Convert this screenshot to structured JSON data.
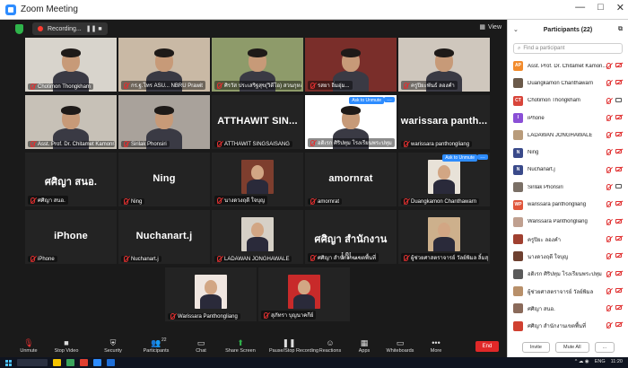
{
  "window": {
    "title": "Zoom Meeting",
    "controls": [
      "—",
      "□",
      "✕"
    ]
  },
  "meeting": {
    "recording_text": "Recording...",
    "recording_controls": "❚❚  ■",
    "view_label": "View",
    "tiles": [
      {
        "label": "Chotimon Thongkham",
        "type": "video",
        "bg": "#d8d4cc"
      },
      {
        "label": "กร.ฐ.โทร ASU...  NBRU Prawit",
        "type": "video",
        "bg": "#c9b9a5"
      },
      {
        "label": "ศิรวัส ประเสริฐสุข(วิดีโอ) สวนกุหลาบ นนทบุรี",
        "type": "video",
        "bg": "#8e9b6a"
      },
      {
        "label": "รสยา  อิ่มอุ่ม... ",
        "type": "video",
        "bg": "#7a2e2a",
        "active": true
      },
      {
        "label": "ครูปิยะพันธ์ ลองคำ",
        "type": "video",
        "bg": "#cfc7bd"
      },
      {
        "label": "Asst. Prof. Dr. Chitamet Kamonrat",
        "type": "video",
        "bg": "#c7c1b7"
      },
      {
        "label": "Sirilak Phonsiri",
        "type": "video",
        "bg": "#a9a29b"
      },
      {
        "label": "ATTHAWIT SINGSAISANG",
        "type": "name",
        "name": "ATTHAWIT SIN..."
      },
      {
        "label": "อดิเรก ศิริปทุม โรงเรียนพระปทุม",
        "type": "video",
        "bg": "#ffffff",
        "chip": "Ask to Unmute"
      },
      {
        "label": "warissara panthongliang",
        "type": "name",
        "name": "warissara  panth..."
      },
      {
        "label": "ศศิญา สนอ.",
        "type": "name",
        "name": "ศศิญา สนอ."
      },
      {
        "label": "Ning",
        "type": "name",
        "name": "Ning"
      },
      {
        "label": "นางดวงฤดี ใจบุญ",
        "type": "photo",
        "bg": "#7e3e2e"
      },
      {
        "label": "amornrat",
        "type": "name",
        "name": "amornrat"
      },
      {
        "label": "Duangkamon Chanthawarn",
        "type": "photo",
        "bg": "#e8e2d8",
        "chip": "Ask to Unmute"
      },
      {
        "label": "iPhone",
        "type": "name",
        "name": "iPhone"
      },
      {
        "label": "Nuchanart.j",
        "type": "name",
        "name": "Nuchanart.j"
      },
      {
        "label": "LADAWAN JONGHAWALE",
        "type": "photo",
        "bg": "#d6d0c6"
      },
      {
        "label": "ศศิญา สำนักงานเขตพื้นที่",
        "type": "name",
        "name": "ศศิญา สำนักงานเข..."
      },
      {
        "label": "ผู้ช่วยศาสตราจารย์ วัลย์พิมล ลิ้มสุดใจ",
        "type": "photo",
        "bg": "#cdb08c"
      },
      {
        "label": "Warissara Panthongliang",
        "type": "photo",
        "bg": "#f0e6e0"
      },
      {
        "label": "สุภัทรา บุญนาคกีย์",
        "type": "photo",
        "bg": "#c82a2a"
      }
    ]
  },
  "toolbar": {
    "items": [
      {
        "label": "Unmute",
        "icon": "mic-muted-icon"
      },
      {
        "label": "Stop Video",
        "icon": "video-icon"
      },
      {
        "label": "Security",
        "icon": "shield-icon"
      },
      {
        "label": "Participants",
        "icon": "participants-icon",
        "count": "22"
      },
      {
        "label": "Chat",
        "icon": "chat-icon"
      },
      {
        "label": "Share Screen",
        "icon": "share-screen-icon"
      },
      {
        "label": "Pause/Stop Recording",
        "icon": "pause-recording-icon"
      },
      {
        "label": "Reactions",
        "icon": "reactions-icon"
      },
      {
        "label": "Apps",
        "icon": "apps-icon"
      },
      {
        "label": "Whiteboards",
        "icon": "whiteboard-icon"
      },
      {
        "label": "More",
        "icon": "more-icon"
      }
    ],
    "end_label": "End"
  },
  "panel": {
    "title": "Participants (22)",
    "search_placeholder": "Find a participant",
    "participants": [
      {
        "name": "Asst. Prof. Dr. Chitamet Kamon...",
        "initials": "AP",
        "color": "#f28b2c",
        "cam": "off"
      },
      {
        "name": "Duangkamon Chanthawarn",
        "initials": "",
        "color": "#6b5a4a",
        "cam": "off"
      },
      {
        "name": "Chotimon Thongkham",
        "initials": "CT",
        "color": "#d8453a",
        "cam": "on"
      },
      {
        "name": "iPhone",
        "initials": "I",
        "color": "#8a4fd6",
        "cam": "off"
      },
      {
        "name": "LADAWAN JONGHAWALE",
        "initials": "",
        "color": "#b89b7a",
        "cam": "off"
      },
      {
        "name": "Ning",
        "initials": "N",
        "color": "#3a4a8a",
        "cam": "off"
      },
      {
        "name": "Nuchanart.j",
        "initials": "N",
        "color": "#3a4a8a",
        "cam": "off"
      },
      {
        "name": "Sirilak Phonsiri",
        "initials": "",
        "color": "#7a6f66",
        "cam": "on"
      },
      {
        "name": "warissara panthongliang",
        "initials": "WP",
        "color": "#e0553a",
        "cam": "off"
      },
      {
        "name": "Warissara Panthongliang",
        "initials": "",
        "color": "#c0a090",
        "cam": "off"
      },
      {
        "name": "ครูปิยะ ลองคำ",
        "initials": "",
        "color": "#a04030",
        "cam": "off"
      },
      {
        "name": "นางดวงฤดี ใจบุญ",
        "initials": "",
        "color": "#6e4030",
        "cam": "off"
      },
      {
        "name": "อดิเรก ศิริปทุม โรงเรียนพระปทุม",
        "initials": "",
        "color": "#5a5a5a",
        "cam": "off"
      },
      {
        "name": "ผู้ช่วยศาสตราจารย์ วัลย์พิมล",
        "initials": "",
        "color": "#b8906a",
        "cam": "off"
      },
      {
        "name": "ศศิญา สนอ.",
        "initials": "",
        "color": "#8a6a5a",
        "cam": "off"
      },
      {
        "name": "ศศิญา สำนักงานเขตพื้นที่",
        "initials": "",
        "color": "#d04030",
        "cam": "off"
      }
    ],
    "invite_label": "Invite",
    "mute_all_label": "Mute All",
    "more_label": "..."
  },
  "taskbar": {
    "language": "ENG",
    "time": "11:20",
    "tray_icons": "^  ☁  ◉"
  }
}
